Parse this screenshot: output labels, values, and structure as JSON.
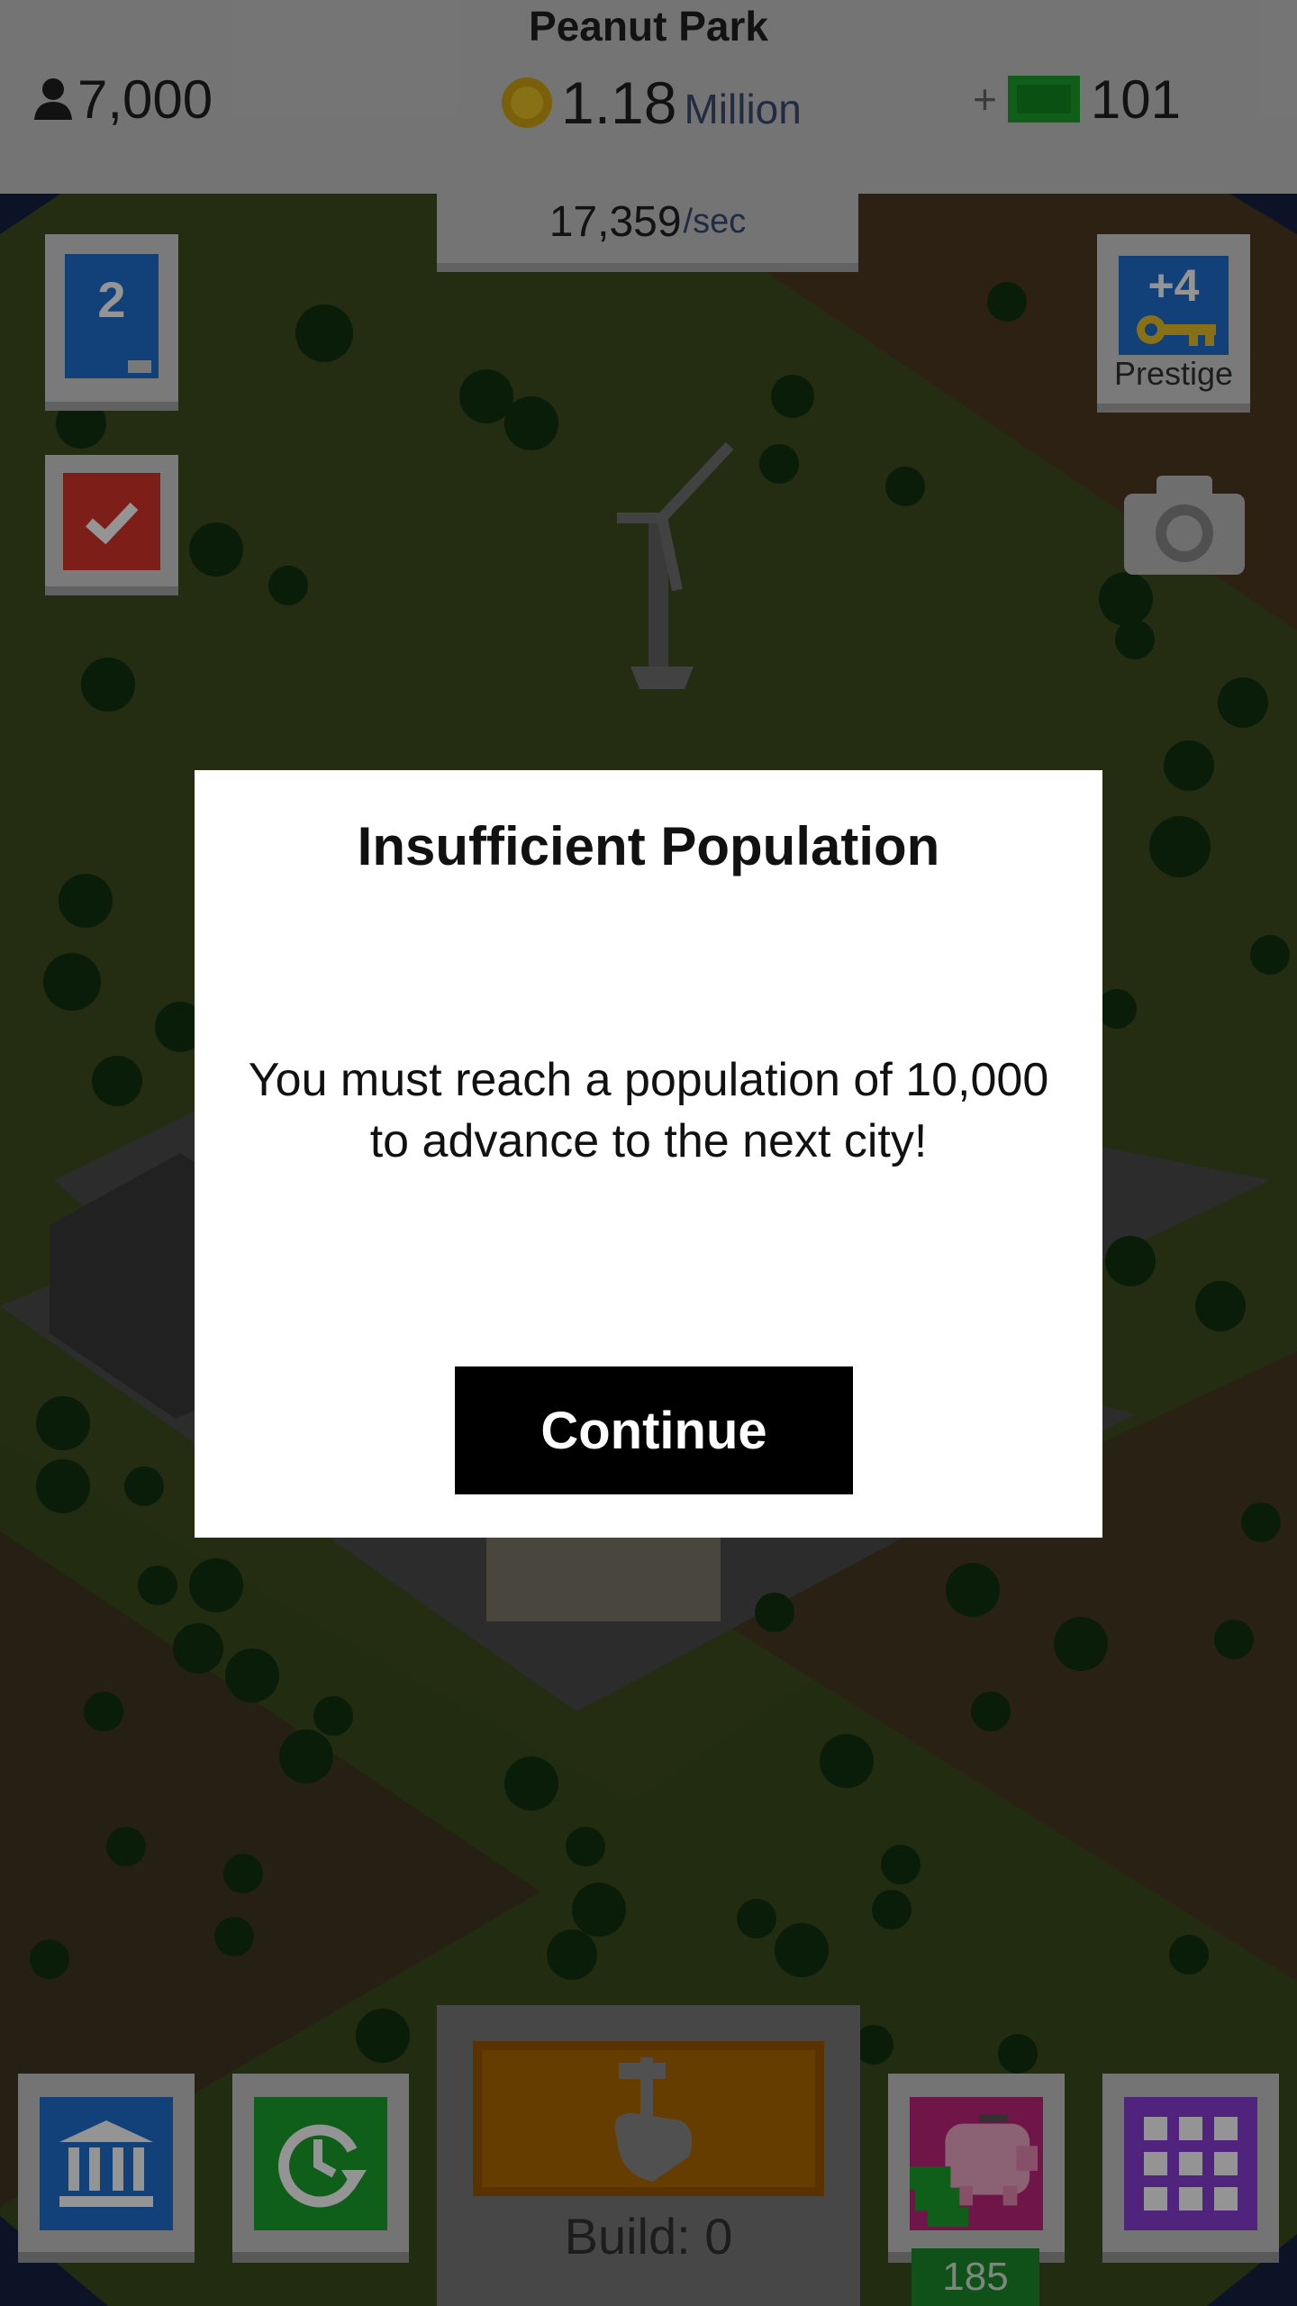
{
  "header": {
    "city_name": "Peanut Park",
    "population": "7,000",
    "coins_value": "1.18",
    "coins_unit": "Million",
    "cash_plus": "+",
    "cash_value": "101",
    "rate_value": "17,359",
    "rate_unit": "/sec"
  },
  "side": {
    "level": "2",
    "level_progress": 0.7,
    "prestige_plus": "+4",
    "prestige_label": "Prestige"
  },
  "dialog": {
    "title": "Insufficient Population",
    "message": "You must reach a population of 10,000 to advance to the next city!",
    "continue_label": "Continue"
  },
  "bottom": {
    "build_label": "Build: 0",
    "piggy_count": "185"
  },
  "colors": {
    "accent_blue": "#1f6fd1",
    "accent_green": "#1aa32d",
    "accent_red": "#d9342b",
    "accent_purple": "#8b3fd6",
    "accent_pink": "#c0257a"
  }
}
